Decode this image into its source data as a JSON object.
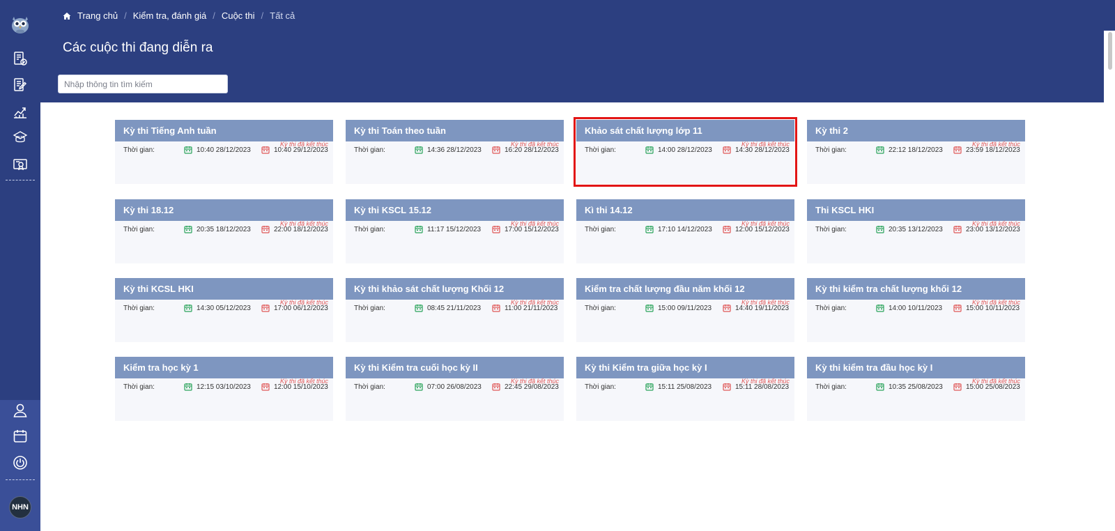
{
  "breadcrumb": [
    {
      "label": "Trang chủ"
    },
    {
      "label": "Kiểm tra, đánh giá"
    },
    {
      "label": "Cuộc thi"
    },
    {
      "label": "Tất cả"
    }
  ],
  "title": "Các cuộc thi đang diễn ra",
  "search": {
    "placeholder": "Nhập thông tin tìm kiếm",
    "value": ""
  },
  "user": {
    "initials": "NHN"
  },
  "colors": {
    "primary": "#2c3f80",
    "card_header": "#7e96c0",
    "start_icon": "#29a35a",
    "end_icon": "#e05757",
    "status": "#e05757",
    "highlight": "#e21515"
  },
  "sidebar_icons": [
    "owl-logo-icon",
    "exam-check-icon",
    "edit-document-icon",
    "chart-up-icon",
    "ielts-icon",
    "certificate-icon",
    "user-icon",
    "calendar-icon",
    "power-icon"
  ],
  "card_common": {
    "time_label": "Thời gian:",
    "status": "Kỳ thi đã kết thúc"
  },
  "highlighted_card": 2,
  "cards": [
    {
      "title": "Kỳ thi Tiếng Anh tuần",
      "start": "10:40 28/12/2023",
      "end": "10:40 29/12/2023"
    },
    {
      "title": "Kỳ thi Toán theo tuần",
      "start": "14:36 28/12/2023",
      "end": "16:20 28/12/2023"
    },
    {
      "title": "Khảo sát chất lượng lớp 11",
      "start": "14:00 28/12/2023",
      "end": "14:30 28/12/2023"
    },
    {
      "title": "Kỳ thi 2",
      "start": "22:12 18/12/2023",
      "end": "23:59 18/12/2023"
    },
    {
      "title": "Kỳ thi 18.12",
      "start": "20:35 18/12/2023",
      "end": "22:00 18/12/2023"
    },
    {
      "title": "Kỳ thi KSCL 15.12",
      "start": "11:17 15/12/2023",
      "end": "17:00 15/12/2023"
    },
    {
      "title": "Kì thi 14.12",
      "start": "17:10 14/12/2023",
      "end": "12:00 15/12/2023"
    },
    {
      "title": "Thi KSCL HKI",
      "start": "20:35 13/12/2023",
      "end": "23:00 13/12/2023"
    },
    {
      "title": "Kỳ thi KCSL HKI",
      "start": "14:30 05/12/2023",
      "end": "17:00 06/12/2023"
    },
    {
      "title": "Kỳ thi khảo sát chất lượng Khối 12",
      "start": "08:45 21/11/2023",
      "end": "11:00 21/11/2023"
    },
    {
      "title": "Kiểm tra chất lượng đầu năm khối 12",
      "start": "15:00 09/11/2023",
      "end": "14:40 19/11/2023"
    },
    {
      "title": "Kỳ thi kiểm tra chất lượng khối 12",
      "start": "14:00 10/11/2023",
      "end": "15:00 10/11/2023"
    },
    {
      "title": "Kiểm tra học kỳ 1",
      "start": "12:15 03/10/2023",
      "end": "12:00 15/10/2023"
    },
    {
      "title": "Kỳ thi Kiểm tra cuối học kỳ II",
      "start": "07:00 26/08/2023",
      "end": "22:45 29/08/2023"
    },
    {
      "title": "Kỳ thi Kiểm tra giữa học kỳ I",
      "start": "15:11 25/08/2023",
      "end": "15:11 28/08/2023"
    },
    {
      "title": "Kỳ thi kiểm tra đầu học kỳ I",
      "start": "10:35 25/08/2023",
      "end": "15:00 25/08/2023"
    }
  ]
}
